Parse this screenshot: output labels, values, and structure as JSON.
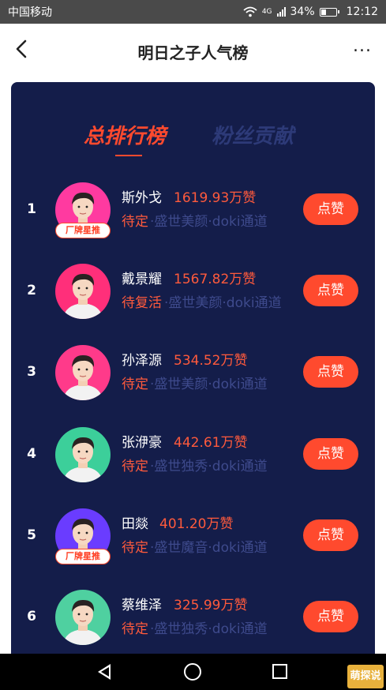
{
  "status_bar": {
    "carrier": "中国移动",
    "network": "4G",
    "battery": "34%",
    "battery_level": 0.34,
    "time": "12:12"
  },
  "header": {
    "back_icon": "chevron-left-icon",
    "title": "明日之子人气榜",
    "more_icon": "more-dots-icon",
    "more_label": "···"
  },
  "tabs": [
    {
      "label": "总排行榜",
      "active": true
    },
    {
      "label": "粉丝贡献",
      "active": false
    }
  ],
  "colors": {
    "accent": "#ff4a2e",
    "panel_bg": "#141d4a",
    "muted_text": "#3e4a8c"
  },
  "ranking": [
    {
      "rank": "1",
      "name": "斯外戈",
      "likes": "1619.93万赞",
      "status": "待定",
      "source": "·盛世美颜·doki通道",
      "badge": "厂牌星推",
      "button": "点赞",
      "avatar_bg": "#ff3aa0"
    },
    {
      "rank": "2",
      "name": "戴景耀",
      "likes": "1567.82万赞",
      "status": "待复活",
      "source": "·盛世美颜·doki通道",
      "badge": "",
      "button": "点赞",
      "avatar_bg": "#ff2f7a"
    },
    {
      "rank": "3",
      "name": "孙泽源",
      "likes": "534.52万赞",
      "status": "待定",
      "source": "·盛世美颜·doki通道",
      "badge": "",
      "button": "点赞",
      "avatar_bg": "#ff3a8a"
    },
    {
      "rank": "4",
      "name": "张洢豪",
      "likes": "442.61万赞",
      "status": "待定",
      "source": "·盛世独秀·doki通道",
      "badge": "",
      "button": "点赞",
      "avatar_bg": "#3ccf9a"
    },
    {
      "rank": "5",
      "name": "田燚",
      "likes": "401.20万赞",
      "status": "待定",
      "source": "·盛世魔音·doki通道",
      "badge": "厂牌星推",
      "button": "点赞",
      "avatar_bg": "#6a3cff"
    },
    {
      "rank": "6",
      "name": "蔡维泽",
      "likes": "325.99万赞",
      "status": "待定",
      "source": "·盛世独秀·doki通道",
      "badge": "",
      "button": "点赞",
      "avatar_bg": "#4fd0a0"
    }
  ],
  "watermark": "萌探说"
}
